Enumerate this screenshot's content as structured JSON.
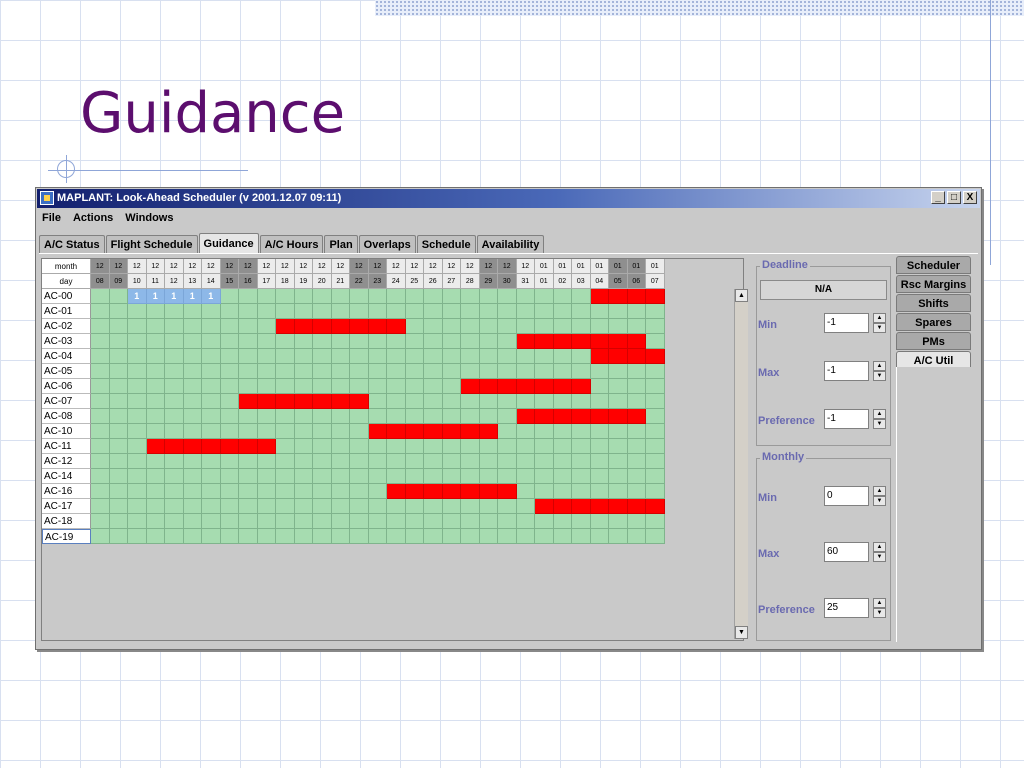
{
  "slide": {
    "title": "Guidance"
  },
  "window": {
    "title": "MAPLANT: Look-Ahead Scheduler  (v 2001.12.07 09:11)",
    "buttons": [
      "_",
      "□",
      "X"
    ]
  },
  "menu": [
    "File",
    "Actions",
    "Windows"
  ],
  "tabs": [
    "A/C Status",
    "Flight Schedule",
    "Guidance",
    "A/C Hours",
    "Plan",
    "Overlaps",
    "Schedule",
    "Availability"
  ],
  "active_tab": "Guidance",
  "grid": {
    "header_labels": {
      "month": "month",
      "day": "day"
    },
    "columns": [
      {
        "m": "12",
        "d": "08",
        "shade": "gray"
      },
      {
        "m": "12",
        "d": "09",
        "shade": "gray"
      },
      {
        "m": "12",
        "d": "10",
        "shade": "white"
      },
      {
        "m": "12",
        "d": "11",
        "shade": "white"
      },
      {
        "m": "12",
        "d": "12",
        "shade": "white"
      },
      {
        "m": "12",
        "d": "13",
        "shade": "white"
      },
      {
        "m": "12",
        "d": "14",
        "shade": "white"
      },
      {
        "m": "12",
        "d": "15",
        "shade": "gray"
      },
      {
        "m": "12",
        "d": "16",
        "shade": "gray"
      },
      {
        "m": "12",
        "d": "17",
        "shade": "white"
      },
      {
        "m": "12",
        "d": "18",
        "shade": "white"
      },
      {
        "m": "12",
        "d": "19",
        "shade": "white"
      },
      {
        "m": "12",
        "d": "20",
        "shade": "white"
      },
      {
        "m": "12",
        "d": "21",
        "shade": "white"
      },
      {
        "m": "12",
        "d": "22",
        "shade": "gray"
      },
      {
        "m": "12",
        "d": "23",
        "shade": "gray"
      },
      {
        "m": "12",
        "d": "24",
        "shade": "white"
      },
      {
        "m": "12",
        "d": "25",
        "shade": "white"
      },
      {
        "m": "12",
        "d": "26",
        "shade": "white"
      },
      {
        "m": "12",
        "d": "27",
        "shade": "white"
      },
      {
        "m": "12",
        "d": "28",
        "shade": "white"
      },
      {
        "m": "12",
        "d": "29",
        "shade": "gray"
      },
      {
        "m": "12",
        "d": "30",
        "shade": "gray"
      },
      {
        "m": "12",
        "d": "31",
        "shade": "white"
      },
      {
        "m": "01",
        "d": "01",
        "shade": "white"
      },
      {
        "m": "01",
        "d": "02",
        "shade": "white"
      },
      {
        "m": "01",
        "d": "03",
        "shade": "white"
      },
      {
        "m": "01",
        "d": "04",
        "shade": "white"
      },
      {
        "m": "01",
        "d": "05",
        "shade": "gray"
      },
      {
        "m": "01",
        "d": "06",
        "shade": "gray"
      },
      {
        "m": "01",
        "d": "07",
        "shade": "white"
      }
    ],
    "rows": [
      {
        "label": "AC-00",
        "red": [
          [
            27,
            30
          ]
        ],
        "blue": [
          [
            2,
            6
          ]
        ],
        "blue_text": "1"
      },
      {
        "label": "AC-01",
        "red": [],
        "blue": []
      },
      {
        "label": "AC-02",
        "red": [
          [
            10,
            16
          ]
        ],
        "blue": []
      },
      {
        "label": "AC-03",
        "red": [
          [
            23,
            29
          ]
        ],
        "blue": []
      },
      {
        "label": "AC-04",
        "red": [
          [
            27,
            30
          ]
        ],
        "blue": []
      },
      {
        "label": "AC-05",
        "red": [],
        "blue": []
      },
      {
        "label": "AC-06",
        "red": [
          [
            20,
            26
          ]
        ],
        "blue": []
      },
      {
        "label": "AC-07",
        "red": [
          [
            8,
            14
          ]
        ],
        "blue": []
      },
      {
        "label": "AC-08",
        "red": [
          [
            23,
            29
          ]
        ],
        "blue": []
      },
      {
        "label": "AC-10",
        "red": [
          [
            15,
            21
          ]
        ],
        "blue": []
      },
      {
        "label": "AC-11",
        "red": [
          [
            3,
            9
          ]
        ],
        "blue": []
      },
      {
        "label": "AC-12",
        "red": [],
        "blue": []
      },
      {
        "label": "AC-14",
        "red": [],
        "blue": []
      },
      {
        "label": "AC-16",
        "red": [
          [
            16,
            22
          ]
        ],
        "blue": []
      },
      {
        "label": "AC-17",
        "red": [
          [
            24,
            30
          ]
        ],
        "blue": []
      },
      {
        "label": "AC-18",
        "red": [],
        "blue": []
      },
      {
        "label": "AC-19",
        "red": [],
        "blue": []
      }
    ]
  },
  "deadline": {
    "legend": "Deadline",
    "status": "N/A",
    "min_label": "Min",
    "min": "-1",
    "max_label": "Max",
    "max": "-1",
    "pref_label": "Preference",
    "pref": "-1"
  },
  "monthly": {
    "legend": "Monthly",
    "min_label": "Min",
    "min": "0",
    "max_label": "Max",
    "max": "60",
    "pref_label": "Preference",
    "pref": "25"
  },
  "side_tabs": [
    "Scheduler",
    "Rsc Margins",
    "Shifts",
    "Spares",
    "PMs",
    "A/C Util"
  ],
  "active_side_tab": "A/C Util",
  "colors": {
    "cell": "#a6dcb0",
    "busy": "#ff0000",
    "selected": "#8db8e8",
    "title": "#5c0e6e"
  }
}
